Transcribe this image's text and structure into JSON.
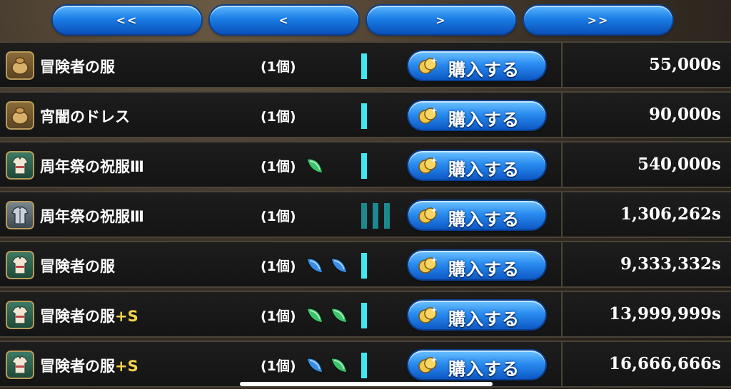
{
  "pager": {
    "first_label": "<<",
    "prev_label": "<",
    "next_label": ">",
    "last_label": ">>"
  },
  "buy_label": "購入する",
  "items": [
    {
      "icon": "pouch-icon",
      "name": "冒険者の服",
      "suffix": "",
      "qty": "(1個)",
      "gems": [],
      "bars": 1,
      "price": "55,000s"
    },
    {
      "icon": "pouch-icon",
      "name": "宵闇のドレス",
      "suffix": "",
      "qty": "(1個)",
      "gems": [],
      "bars": 1,
      "price": "90,000s"
    },
    {
      "icon": "tunic-icon",
      "name": "周年祭の祝服Ⅲ",
      "suffix": "",
      "qty": "(1個)",
      "gems": [
        "green"
      ],
      "bars": 1,
      "price": "540,000s"
    },
    {
      "icon": "armor-icon",
      "name": "周年祭の祝服Ⅲ",
      "suffix": "",
      "qty": "(1個)",
      "gems": [],
      "bars": 3,
      "price": "1,306,262s"
    },
    {
      "icon": "tunic-icon",
      "name": "冒険者の服",
      "suffix": "",
      "qty": "(1個)",
      "gems": [
        "blue",
        "blue"
      ],
      "bars": 1,
      "price": "9,333,332s"
    },
    {
      "icon": "tunic-icon",
      "name": "冒険者の服",
      "suffix": "+S",
      "qty": "(1個)",
      "gems": [
        "green",
        "green"
      ],
      "bars": 1,
      "price": "13,999,999s"
    },
    {
      "icon": "tunic-icon",
      "name": "冒険者の服",
      "suffix": "+S",
      "qty": "(1個)",
      "gems": [
        "blue",
        "green"
      ],
      "bars": 1,
      "price": "16,666,666s"
    }
  ],
  "colors": {
    "accent_bar": "#3fe8f0",
    "button_blue": "#2a8cf0",
    "suffix_gold": "#f2d24a",
    "gem_green": "#3ec46a",
    "gem_blue": "#3a8ee8"
  }
}
